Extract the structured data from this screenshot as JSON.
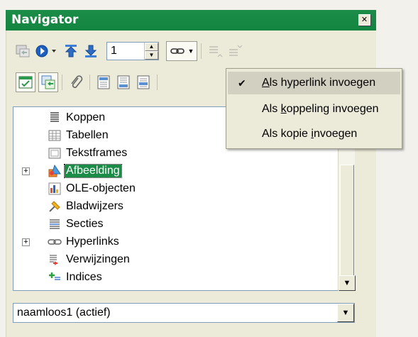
{
  "window": {
    "title": "Navigator"
  },
  "toolbar1": {
    "page_number": "1",
    "icons": [
      "navigation-toggle-icon",
      "navigate-by-icon",
      "previous-icon",
      "next-icon",
      "page-spin",
      "drag-mode-icon",
      "promote-level-icon",
      "demote-level-icon"
    ]
  },
  "toolbar2": {
    "icons": [
      "list-box-toggle-icon",
      "content-view-icon",
      "reminder-icon",
      "header-icon",
      "footer-icon",
      "anchor-text-icon"
    ]
  },
  "tree": {
    "items": [
      {
        "label": "Koppen",
        "icon": "headings-icon",
        "expandable": false,
        "selected": false
      },
      {
        "label": "Tabellen",
        "icon": "table-icon",
        "expandable": false,
        "selected": false
      },
      {
        "label": "Tekstframes",
        "icon": "frame-icon",
        "expandable": false,
        "selected": false
      },
      {
        "label": "Afbeelding",
        "icon": "graphics-icon",
        "expandable": true,
        "selected": true
      },
      {
        "label": "OLE-objecten",
        "icon": "ole-object-icon",
        "expandable": false,
        "selected": false
      },
      {
        "label": "Bladwijzers",
        "icon": "bookmark-icon",
        "expandable": false,
        "selected": false
      },
      {
        "label": "Secties",
        "icon": "section-icon",
        "expandable": false,
        "selected": false
      },
      {
        "label": "Hyperlinks",
        "icon": "hyperlink-icon",
        "expandable": true,
        "selected": false
      },
      {
        "label": "Verwijzingen",
        "icon": "reference-icon",
        "expandable": false,
        "selected": false
      },
      {
        "label": "Indices",
        "icon": "index-icon",
        "expandable": false,
        "selected": false
      }
    ]
  },
  "document": {
    "selected": "naamloos1 (actief)"
  },
  "drag_menu": {
    "items": [
      {
        "label": "Als hyperlink invoegen",
        "pre": "",
        "accel": "A",
        "post": "ls hyperlink invoegen",
        "checked": true
      },
      {
        "label": "Als koppeling invoegen",
        "pre": "Als ",
        "accel": "k",
        "post": "oppeling invoegen",
        "checked": false
      },
      {
        "label": "Als kopie invoegen",
        "pre": "Als kopie ",
        "accel": "i",
        "post": "nvoegen",
        "checked": false
      }
    ]
  },
  "colors": {
    "title_bar": "#168a44",
    "selection": "#1b8c47",
    "panel": "#ecead8"
  }
}
